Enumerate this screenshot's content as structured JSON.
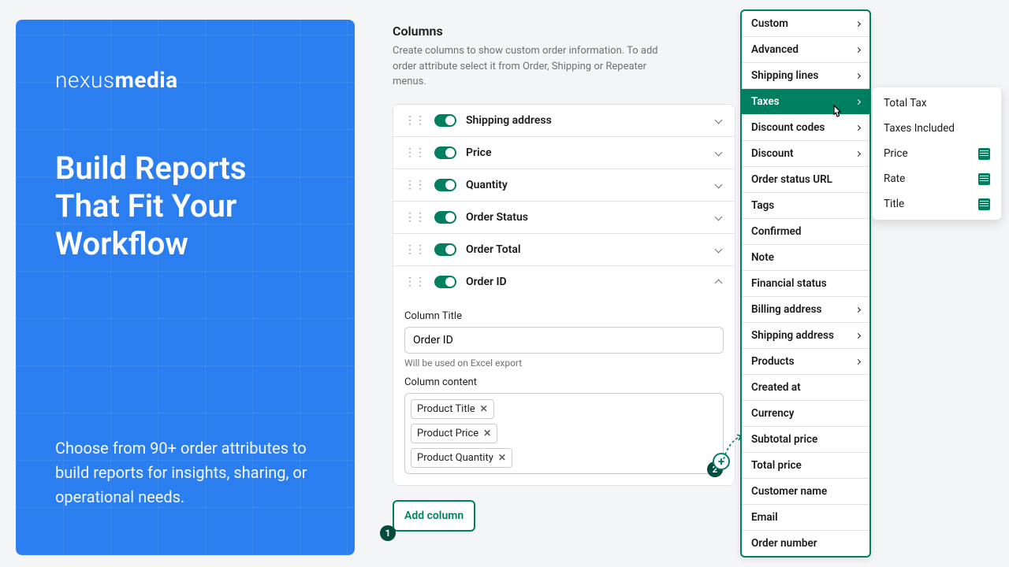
{
  "logo": {
    "first": "nexus",
    "second": "media"
  },
  "headline": "Build Reports That Fit Your Workflow",
  "subtext": "Choose from 90+ order attributes to build reports for insights, sharing, or operational needs.",
  "section": {
    "title": "Columns",
    "desc": "Create columns to show custom order information. To add order attribute select it from Order, Shipping or Repeater menus."
  },
  "columns": [
    {
      "label": "Shipping address"
    },
    {
      "label": "Price"
    },
    {
      "label": "Quantity"
    },
    {
      "label": "Order Status"
    },
    {
      "label": "Order Total"
    },
    {
      "label": "Order ID"
    }
  ],
  "expanded": {
    "title_label": "Column Title",
    "title_value": "Order ID",
    "title_help": "Will be used on Excel export",
    "content_label": "Column content",
    "tags": [
      "Product Title",
      "Product Price",
      "Product Quantity"
    ]
  },
  "add_column_label": "Add column",
  "menu_items": [
    {
      "label": "Custom",
      "arrow": true
    },
    {
      "label": "Advanced",
      "arrow": true
    },
    {
      "label": "Shipping lines",
      "arrow": true
    },
    {
      "label": "Taxes",
      "arrow": true,
      "active": true
    },
    {
      "label": "Discount codes",
      "arrow": true
    },
    {
      "label": "Discount",
      "arrow": true
    },
    {
      "label": "Order status URL",
      "arrow": false
    },
    {
      "label": "Tags",
      "arrow": false
    },
    {
      "label": "Confirmed",
      "arrow": false
    },
    {
      "label": "Note",
      "arrow": false
    },
    {
      "label": "Financial status",
      "arrow": false
    },
    {
      "label": "Billing address",
      "arrow": true
    },
    {
      "label": "Shipping address",
      "arrow": true
    },
    {
      "label": "Products",
      "arrow": true
    },
    {
      "label": "Created at",
      "arrow": false
    },
    {
      "label": "Currency",
      "arrow": false
    },
    {
      "label": "Subtotal price",
      "arrow": false
    },
    {
      "label": "Total price",
      "arrow": false
    },
    {
      "label": "Customer name",
      "arrow": false
    },
    {
      "label": "Email",
      "arrow": false
    },
    {
      "label": "Order number",
      "arrow": false
    }
  ],
  "submenu_items": [
    {
      "label": "Total Tax",
      "icon": false
    },
    {
      "label": "Taxes Included",
      "icon": false
    },
    {
      "label": "Price",
      "icon": true
    },
    {
      "label": "Rate",
      "icon": true
    },
    {
      "label": "Title",
      "icon": true
    }
  ],
  "step_badges": {
    "one": "1",
    "two": "2"
  }
}
